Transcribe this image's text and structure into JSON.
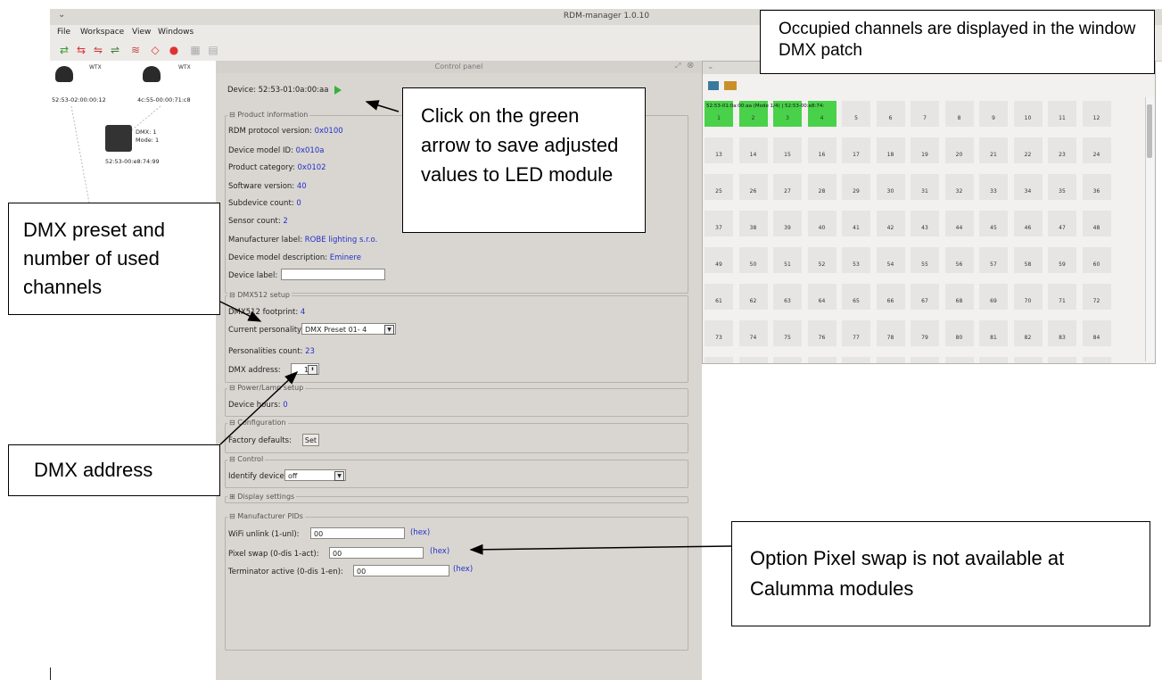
{
  "window": {
    "title": "RDM-manager 1.0.10"
  },
  "menu": [
    "File",
    "Workspace",
    "View",
    "Windows"
  ],
  "toolbar_icons": [
    "discover-icon",
    "add-icon",
    "remove-icon",
    "refresh-icon",
    "wifi-icon",
    "tag-icon",
    "search-icon",
    "grid-icon",
    "list-icon"
  ],
  "tree": {
    "devices": [
      {
        "label": "52:53-02:00:00:12",
        "type": "WTX"
      },
      {
        "label": "4c:55-00:00:71:c8",
        "type": "WTX"
      }
    ],
    "module": {
      "label": "52:53-00:e8:74:99",
      "dmx": "DMX: 1",
      "mode": "Mode: 1"
    }
  },
  "control_panel": {
    "title": "Control panel",
    "device": "Device: 52:53-01:0a:00:aa",
    "product_information": {
      "heading": "Product information",
      "rows": [
        {
          "label": "RDM protocol version:",
          "value": "0x0100"
        },
        {
          "label": "Device model ID:",
          "value": "0x010a"
        },
        {
          "label": "Product category:",
          "value": "0x0102"
        },
        {
          "label": "Software version:",
          "value": "40"
        },
        {
          "label": "Subdevice count:",
          "value": "0"
        },
        {
          "label": "Sensor count:",
          "value": "2"
        },
        {
          "label": "Manufacturer label:",
          "value": "ROBE lighting s.r.o."
        },
        {
          "label": "Device model description:",
          "value": "Eminere"
        }
      ],
      "device_label": "Device label:"
    },
    "dmx512": {
      "heading": "DMX512 setup",
      "footprint_label": "DMX512 footprint:",
      "footprint_value": "4",
      "personality_label": "Current personality:",
      "personality_value": "DMX Preset 01- 4",
      "count_label": "Personalities count:",
      "count_value": "23",
      "address_label": "DMX address:",
      "address_value": "1"
    },
    "power": {
      "heading": "Power/Lamp setup",
      "hours_label": "Device hours:",
      "hours_value": "0"
    },
    "configuration": {
      "heading": "Configuration",
      "factory_label": "Factory defaults:",
      "set_button": "Set"
    },
    "control": {
      "heading": "Control",
      "identify_label": "Identify device:",
      "identify_value": "off"
    },
    "display": {
      "heading": "Display settings"
    },
    "manufacturer": {
      "heading": "Manufacturer PIDs",
      "rows": [
        {
          "label": "WiFi unlink (1-unl):",
          "value": "00",
          "unit": "(hex)"
        },
        {
          "label": "Pixel swap (0-dis 1-act):",
          "value": "00",
          "unit": "(hex)"
        },
        {
          "label": "Terminator active (0-dis 1-en):",
          "value": "00",
          "unit": "(hex)"
        }
      ]
    }
  },
  "patch": {
    "occupied_label": "52:53-01:0a:00:aa (Mode 1/4) | 52:53-00:e8:74:",
    "channels": [
      1,
      2,
      3,
      4,
      5,
      6,
      7,
      8,
      9,
      10,
      11,
      12,
      13,
      14,
      15,
      16,
      17,
      18,
      19,
      20,
      21,
      22,
      23,
      24,
      25,
      26,
      27,
      28,
      29,
      30,
      31,
      32,
      33,
      34,
      35,
      36,
      37,
      38,
      39,
      40,
      41,
      42,
      43,
      44,
      45,
      46,
      47,
      48,
      49,
      50,
      51,
      52,
      53,
      54,
      55,
      56,
      57,
      58,
      59,
      60,
      61,
      62,
      63,
      64,
      65,
      66,
      67,
      68,
      69,
      70,
      71,
      72,
      73,
      74,
      75,
      76,
      77,
      78,
      79,
      80,
      81,
      82,
      83,
      84
    ],
    "occupied_count": 4
  },
  "callouts": {
    "occupied": "Occupied channels are displayed in the window DMX patch",
    "green_arrow": "Click on the green arrow to save adjusted values to LED module",
    "preset": "DMX preset and number of used channels",
    "address": "DMX address",
    "pixel_swap": "Option Pixel swap is not available at Calumma modules"
  },
  "colors": {
    "occupied": "#49d14a",
    "value_text": "#2330c8",
    "panel_bg": "#d9d6d1"
  }
}
